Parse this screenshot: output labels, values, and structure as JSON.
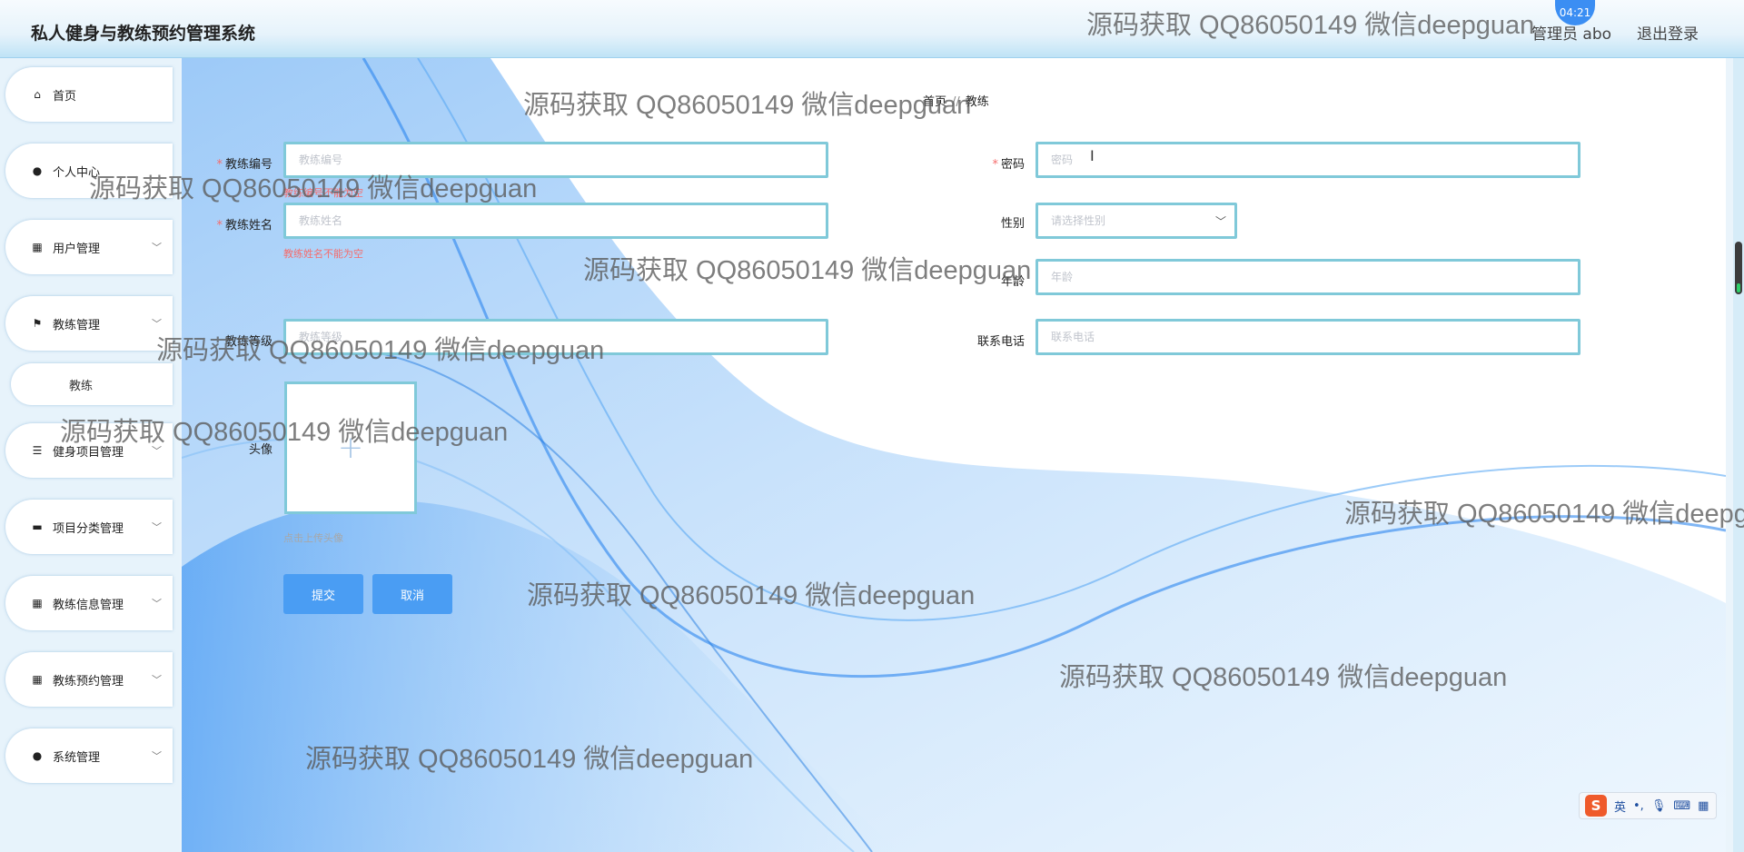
{
  "app": {
    "title": "私人健身与教练预约管理系统"
  },
  "topbar": {
    "user": "管理员 abo",
    "logout": "退出登录",
    "clock": "04:21"
  },
  "sidebar": {
    "items": [
      {
        "label": "首页",
        "icon": "home-icon"
      },
      {
        "label": "个人中心",
        "icon": "person-icon"
      },
      {
        "label": "用户管理",
        "icon": "grid-icon"
      },
      {
        "label": "教练管理",
        "icon": "flag-icon"
      },
      {
        "label": "教练",
        "icon": ""
      },
      {
        "label": "健身项目管理",
        "icon": "sliders-icon"
      },
      {
        "label": "项目分类管理",
        "icon": "box-icon"
      },
      {
        "label": "教练信息管理",
        "icon": "grid-icon"
      },
      {
        "label": "教练预约管理",
        "icon": "grid-icon"
      },
      {
        "label": "系统管理",
        "icon": "person-icon"
      }
    ]
  },
  "breadcrumb": {
    "home": "首页",
    "separator": "//",
    "current": "教练"
  },
  "form": {
    "coach_no": {
      "label": "教练编号",
      "placeholder": "教练编号",
      "error": "教练编号不能为空"
    },
    "coach_name": {
      "label": "教练姓名",
      "placeholder": "教练姓名",
      "error": "教练姓名不能为空"
    },
    "coach_level": {
      "label": "教练等级",
      "placeholder": "教练等级"
    },
    "password": {
      "label": "密码",
      "placeholder": "密码"
    },
    "gender": {
      "label": "性别",
      "placeholder": "请选择性别"
    },
    "age": {
      "label": "年龄",
      "placeholder": "年龄"
    },
    "phone": {
      "label": "联系电话",
      "placeholder": "联系电话"
    },
    "avatar": {
      "label": "头像",
      "tip": "点击上传头像"
    },
    "submit": "提交",
    "cancel": "取消"
  },
  "watermark": "源码获取 QQ86050149 微信deepguan",
  "ime": {
    "lang": "英"
  },
  "colors": {
    "accent": "#4a9df3",
    "border": "#80c9d9",
    "error": "#f56c6c"
  }
}
